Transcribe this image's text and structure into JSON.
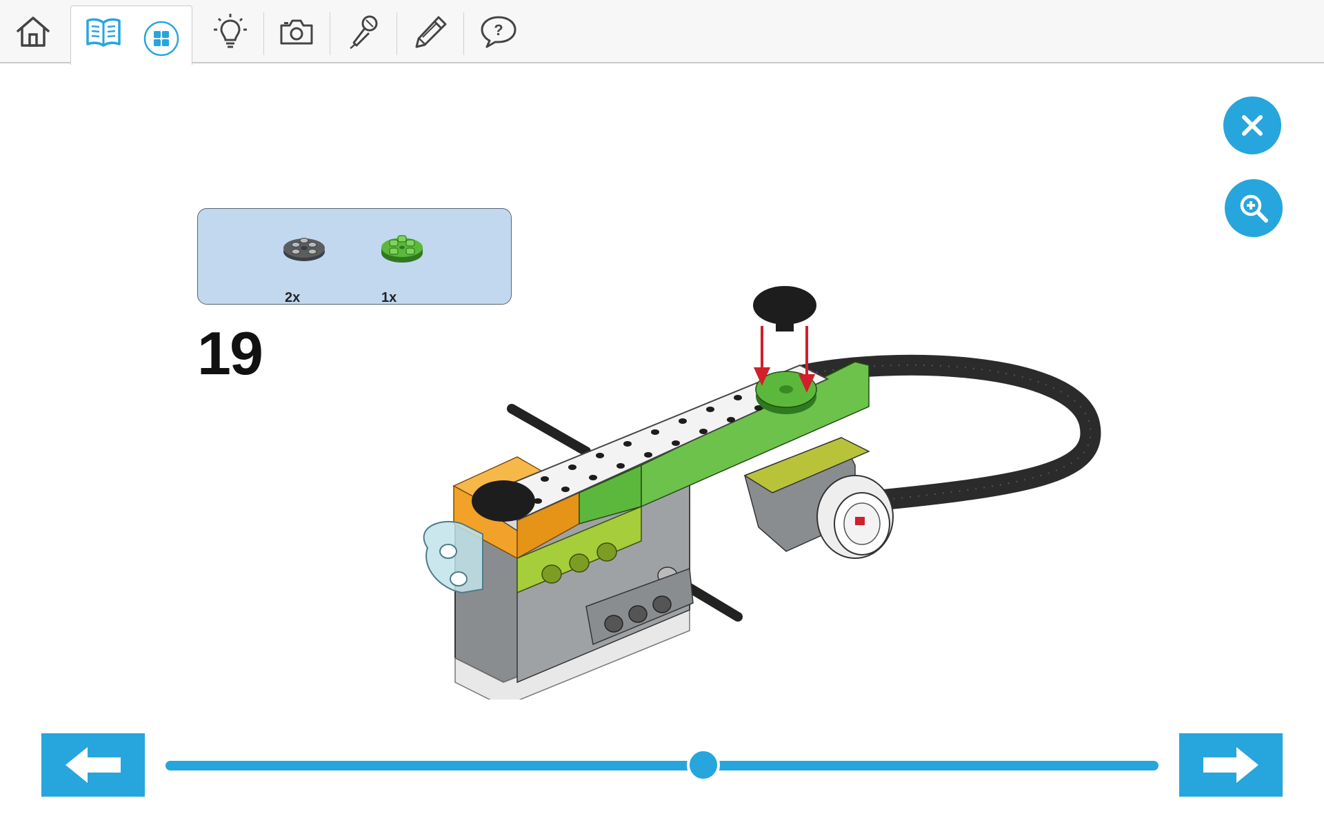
{
  "toolbar": {
    "tools": [
      {
        "name": "home",
        "icon": "home-icon"
      },
      {
        "name": "instructions",
        "icon": "book-icon",
        "active": true
      },
      {
        "name": "overview",
        "icon": "grid-icon",
        "active": true
      },
      {
        "name": "ideas",
        "icon": "lightbulb-icon"
      },
      {
        "name": "camera",
        "icon": "camera-icon"
      },
      {
        "name": "record",
        "icon": "microphone-icon"
      },
      {
        "name": "write",
        "icon": "pencil-icon"
      },
      {
        "name": "help",
        "icon": "question-bubble-icon"
      }
    ]
  },
  "actions": {
    "close_icon": "close-icon",
    "zoom_icon": "zoom-in-icon"
  },
  "parts": [
    {
      "qty": "2x",
      "color": "#5b5e60",
      "icon": "round-plate-gray-icon"
    },
    {
      "qty": "1x",
      "color": "#5cb83c",
      "icon": "round-plate-green-icon"
    }
  ],
  "step": {
    "number": "19"
  },
  "progress": {
    "fraction": 0.542
  },
  "navigation": {
    "prev_icon": "arrow-left-icon",
    "next_icon": "arrow-right-icon"
  },
  "colors": {
    "accent": "#27a5dd",
    "panel": "#c2d8ef",
    "lime": "#a6cd3a",
    "green": "#5cb83c",
    "orange": "#f2a229",
    "arrow": "#d0202a"
  }
}
